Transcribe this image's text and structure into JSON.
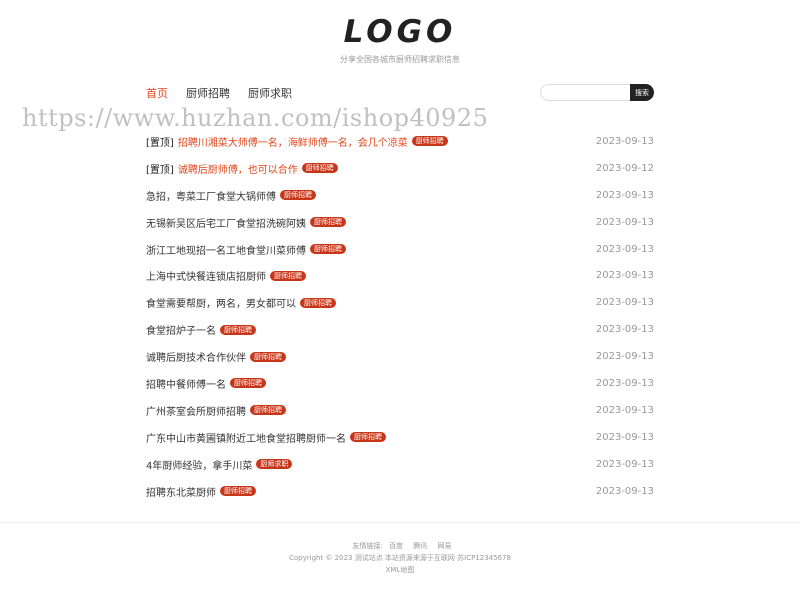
{
  "header": {
    "logo": "LOGO",
    "tagline": "分享全国各城市厨师招聘求职信息"
  },
  "nav": {
    "items": [
      {
        "label": "首页"
      },
      {
        "label": "厨师招聘"
      },
      {
        "label": "厨师求职"
      }
    ]
  },
  "search": {
    "placeholder": "",
    "button_label": "搜索"
  },
  "watermark": "https://www.huzhan.com/ishop40925",
  "posts": [
    {
      "pin": "[置顶]",
      "title": "招聘川湘菜大师傅一名，海鲜师傅一名，会几个凉菜",
      "tag": "厨师招聘",
      "date": "2023-09-13"
    },
    {
      "pin": "[置顶]",
      "title": "诚聘后厨师傅，也可以合作",
      "tag": "厨师招聘",
      "date": "2023-09-12"
    },
    {
      "pin": "",
      "title": "急招，粤菜工厂食堂大锅师傅",
      "tag": "厨师招聘",
      "date": "2023-09-13"
    },
    {
      "pin": "",
      "title": "无锡新吴区后宅工厂食堂招洗碗阿姨",
      "tag": "厨师招聘",
      "date": "2023-09-13"
    },
    {
      "pin": "",
      "title": "浙江工地现招一名工地食堂川菜师傅",
      "tag": "厨师招聘",
      "date": "2023-09-13"
    },
    {
      "pin": "",
      "title": "上海中式快餐连锁店招厨师",
      "tag": "厨师招聘",
      "date": "2023-09-13"
    },
    {
      "pin": "",
      "title": "食堂需要帮厨，两名，男女都可以",
      "tag": "厨师招聘",
      "date": "2023-09-13"
    },
    {
      "pin": "",
      "title": "食堂招炉子一名",
      "tag": "厨师招聘",
      "date": "2023-09-13"
    },
    {
      "pin": "",
      "title": "诚聘后厨技术合作伙伴",
      "tag": "厨师招聘",
      "date": "2023-09-13"
    },
    {
      "pin": "",
      "title": "招聘中餐师傅一名",
      "tag": "厨师招聘",
      "date": "2023-09-13"
    },
    {
      "pin": "",
      "title": "广州茶室会所厨师招聘",
      "tag": "厨师招聘",
      "date": "2023-09-13"
    },
    {
      "pin": "",
      "title": "广东中山市黄圃镇附近工地食堂招聘厨师一名",
      "tag": "厨师招聘",
      "date": "2023-09-13"
    },
    {
      "pin": "",
      "title": "4年厨师经验，拿手川菜",
      "tag": "厨师求职",
      "date": "2023-09-13"
    },
    {
      "pin": "",
      "title": "招聘东北菜厨师",
      "tag": "厨师招聘",
      "date": "2023-09-13"
    }
  ],
  "footer": {
    "links_label": "友情链接:",
    "links": [
      "百度",
      "腾讯",
      "网易"
    ],
    "copyright": "Copyright © 2023 测试站点 本站资源来源于互联网 苏ICP12345678",
    "sitemap": "XML地图"
  },
  "colors": {
    "accent": "#e0461d",
    "badge": "#c8361a"
  }
}
